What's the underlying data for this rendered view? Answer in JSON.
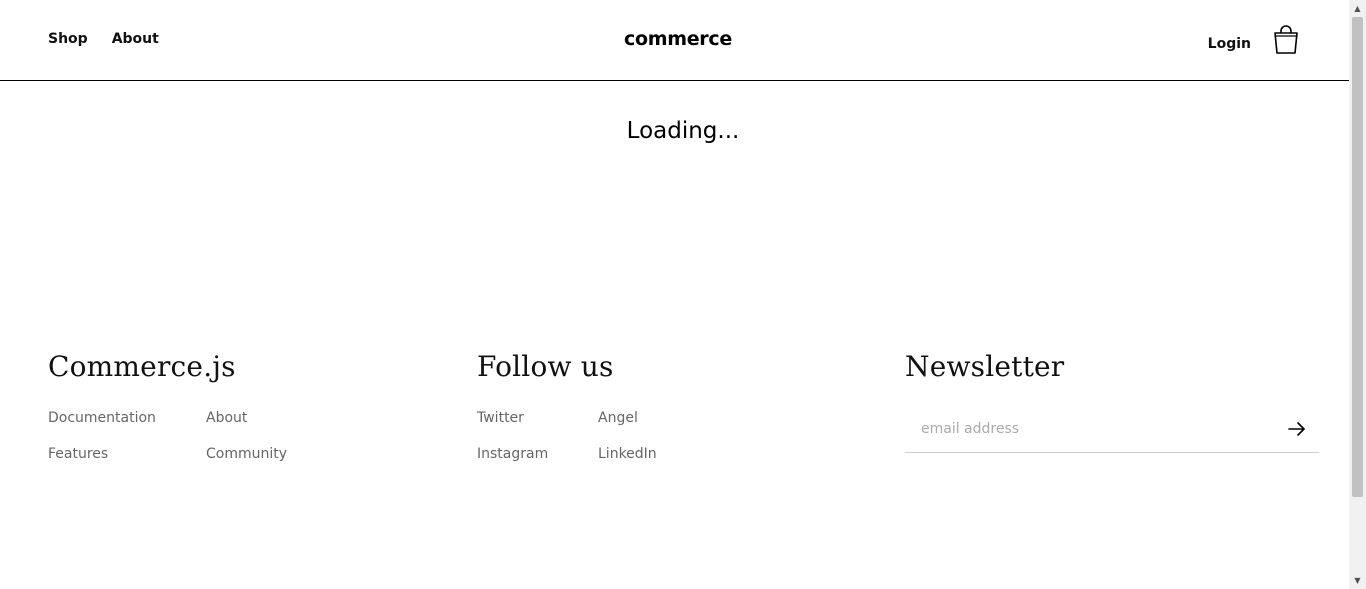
{
  "header": {
    "nav": [
      {
        "label": "Shop"
      },
      {
        "label": "About"
      }
    ],
    "brand": "commerce",
    "login_label": "Login",
    "cart_icon": "shopping-bag-icon"
  },
  "main": {
    "loading_text": "Loading..."
  },
  "footer": {
    "brand_column": {
      "heading": "Commerce.js",
      "links": [
        "Documentation",
        "About",
        "Features",
        "Community"
      ]
    },
    "follow_column": {
      "heading": "Follow us",
      "links": [
        "Twitter",
        "Angel",
        "Instagram",
        "LinkedIn"
      ]
    },
    "newsletter_column": {
      "heading": "Newsletter",
      "email_placeholder": "email address",
      "email_value": "",
      "submit_icon": "arrow-right-icon"
    }
  },
  "colors": {
    "text": "#000000",
    "muted_link": "#666666",
    "divider": "#000000",
    "input_border": "#cccccc"
  }
}
